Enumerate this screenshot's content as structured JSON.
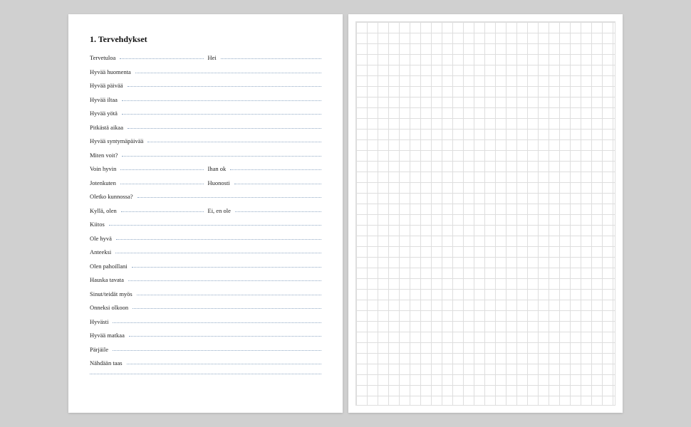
{
  "title": "1. Tervehdykset",
  "rows": [
    {
      "cells": [
        "Tervetuloa",
        "Hei"
      ]
    },
    {
      "cells": [
        "Hyvää huomenta"
      ]
    },
    {
      "cells": [
        "Hyvää päivää"
      ]
    },
    {
      "cells": [
        "Hyvää iltaa"
      ]
    },
    {
      "cells": [
        "Hyvää yötä"
      ]
    },
    {
      "cells": [
        "Pitkästä aikaa"
      ]
    },
    {
      "cells": [
        "Hyvää syntymäpäivää"
      ]
    },
    {
      "cells": [
        "Miten voit?"
      ]
    },
    {
      "cells": [
        "Voin hyvin",
        "Ihan ok"
      ]
    },
    {
      "cells": [
        "Jotenkuten",
        "Huonosti"
      ]
    },
    {
      "cells": [
        "Oletko kunnossa?"
      ]
    },
    {
      "cells": [
        "Kyllä, olen",
        "Ei, en ole"
      ]
    },
    {
      "cells": [
        "Kiitos"
      ]
    },
    {
      "cells": [
        "Ole hyvä"
      ]
    },
    {
      "cells": [
        "Anteeksi"
      ]
    },
    {
      "cells": [
        "Olen pahoillani"
      ]
    },
    {
      "cells": [
        "Hauska tavata"
      ]
    },
    {
      "cells": [
        "Sinut/teidät myös"
      ]
    },
    {
      "cells": [
        "Onneksi olkoon"
      ]
    },
    {
      "cells": [
        "Hyvästi"
      ]
    },
    {
      "cells": [
        "Hyvää matkaa"
      ]
    },
    {
      "cells": [
        "Pärjäile"
      ]
    },
    {
      "cells": [
        "Nähdään taas"
      ]
    },
    {
      "cells": [
        ""
      ]
    }
  ],
  "colors": {
    "dotted_line": "#8fa8c4",
    "grid_line": "#dedede",
    "page_bg": "#ffffff",
    "app_bg": "#d0d0d0"
  }
}
